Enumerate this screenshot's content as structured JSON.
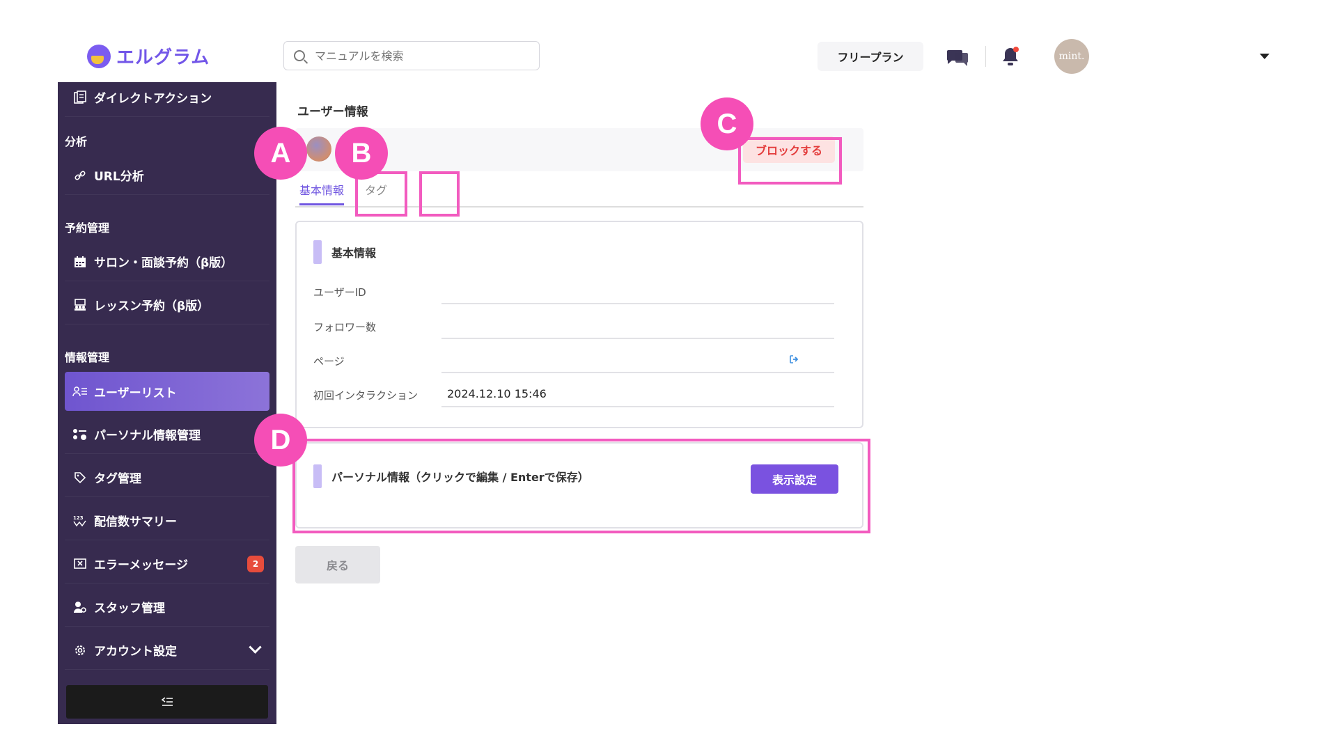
{
  "header": {
    "logo_text": "エルグラム",
    "search_placeholder": "マニュアルを検索",
    "plan_label": "フリープラン",
    "avatar_text": "mint."
  },
  "sidebar": {
    "top_item": "ダイレクトアクション",
    "sections": [
      "分析",
      "予約管理",
      "情報管理"
    ],
    "items": [
      {
        "label": "URL分析",
        "icon": "link-icon"
      },
      {
        "label": "サロン・面談予約（β版）",
        "icon": "calendar-icon"
      },
      {
        "label": "レッスン予約（β版）",
        "icon": "lesson-icon"
      },
      {
        "label": "ユーザーリスト",
        "icon": "user-list-icon",
        "active": true
      },
      {
        "label": "パーソナル情報管理",
        "icon": "personal-info-icon"
      },
      {
        "label": "タグ管理",
        "icon": "tag-icon"
      },
      {
        "label": "配信数サマリー",
        "icon": "summary-icon"
      },
      {
        "label": "エラーメッセージ",
        "icon": "error-icon",
        "badge": "2"
      },
      {
        "label": "スタッフ管理",
        "icon": "staff-icon"
      },
      {
        "label": "アカウント設定",
        "icon": "gear-icon"
      }
    ],
    "collapse_icon": "collapse-menu-icon"
  },
  "main": {
    "section_title": "ユーザー情報",
    "block_button": "ブロックする",
    "tabs": [
      "基本情報",
      "タグ"
    ],
    "basic_card": {
      "title": "基本情報",
      "fields": [
        {
          "label": "ユーザーID",
          "value": ""
        },
        {
          "label": "フォロワー数",
          "value": ""
        },
        {
          "label": "ページ",
          "value": ""
        },
        {
          "label": "初回インタラクション",
          "value": "2024.12.10 15:46"
        }
      ]
    },
    "personal_card": {
      "title": "パーソナル情報（クリックで編集 / Enterで保存）",
      "button": "表示設定"
    },
    "back_button": "戻る"
  },
  "annotations": [
    "A",
    "B",
    "C",
    "D"
  ],
  "colors": {
    "accent": "#7056e0",
    "sidebar_bg": "#372b4f",
    "highlight": "#f25bbf",
    "danger": "#e33b3b"
  }
}
